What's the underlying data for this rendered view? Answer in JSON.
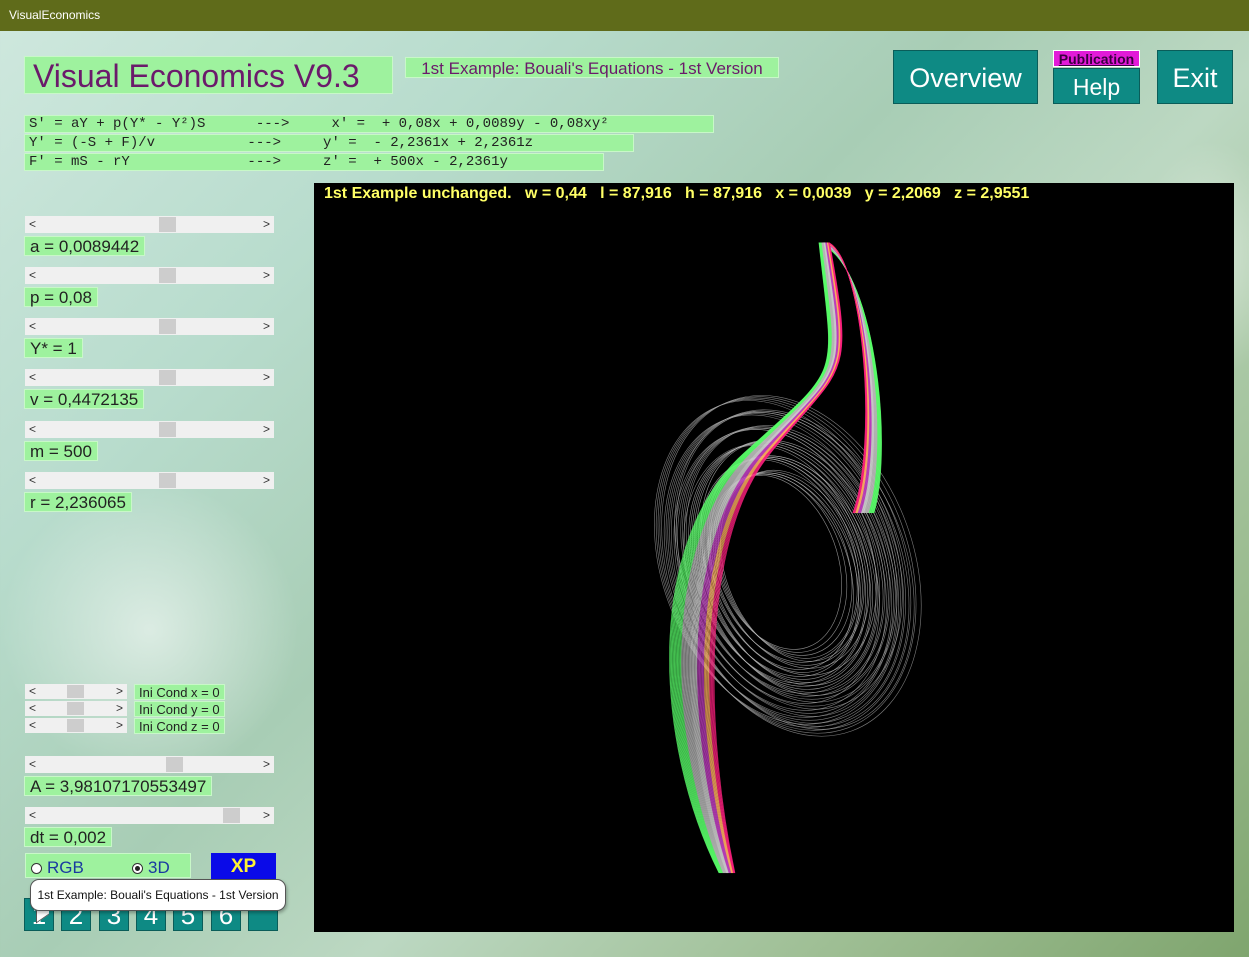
{
  "window": {
    "title": "VisualEconomics"
  },
  "header": {
    "app_title": "Visual Economics V9.3",
    "example_title": "1st Example: Bouali's Equations - 1st Version",
    "overview_label": "Overview",
    "publication_label": "Publication",
    "help_label": "Help",
    "exit_label": "Exit"
  },
  "equations": [
    "S' = aY + p(Y* - Y²)S      --->     x' =  + 0,08x + 0,0089y - 0,08xy²",
    "Y' = (-S + F)/v           --->     y' =  - 2,2361x + 2,2361z",
    "F' = mS - rY              --->     z' =  + 500x - 2,2361y"
  ],
  "parameters": [
    {
      "label": "a = 0,0089442",
      "position": 0.5
    },
    {
      "label": "p = 0,08",
      "position": 0.5
    },
    {
      "label": "Y* = 1",
      "position": 0.5
    },
    {
      "label": "v = 0,4472135",
      "position": 0.5
    },
    {
      "label": "m = 500",
      "position": 0.5
    },
    {
      "label": "r = 2,236065",
      "position": 0.5
    }
  ],
  "initial_conditions": [
    {
      "label": "Ini Cond x = 0",
      "position": 0.5
    },
    {
      "label": "Ini Cond y = 0",
      "position": 0.5
    },
    {
      "label": "Ini Cond z = 0",
      "position": 0.5
    }
  ],
  "amplitude": {
    "label": "A  = 3,98107170553497",
    "position": 0.6
  },
  "timestep": {
    "label": "dt = 0,002",
    "position": 0.85
  },
  "mode": {
    "rgb_label": "RGB",
    "three_d_label": "3D",
    "selected": "3D"
  },
  "xp_label": "XP",
  "example_buttons": [
    "1",
    "2",
    "3",
    "4",
    "5",
    "6",
    ""
  ],
  "tooltip": "1st Example: Bouali's Equations - 1st Version",
  "plot": {
    "status": "1st Example unchanged.   w = 0,44   l = 87,916   h = 87,916   x = 0,0039   y = 2,2069   z = 2,9551",
    "background": "#000000",
    "status_color": "#ffff66"
  },
  "colors": {
    "title_bar": "#5f6b1a",
    "label_bg": "#9ef29e",
    "teal_button": "#0e8a84",
    "publication": "#e21ad8",
    "xp_button": "#0a0ae8"
  }
}
